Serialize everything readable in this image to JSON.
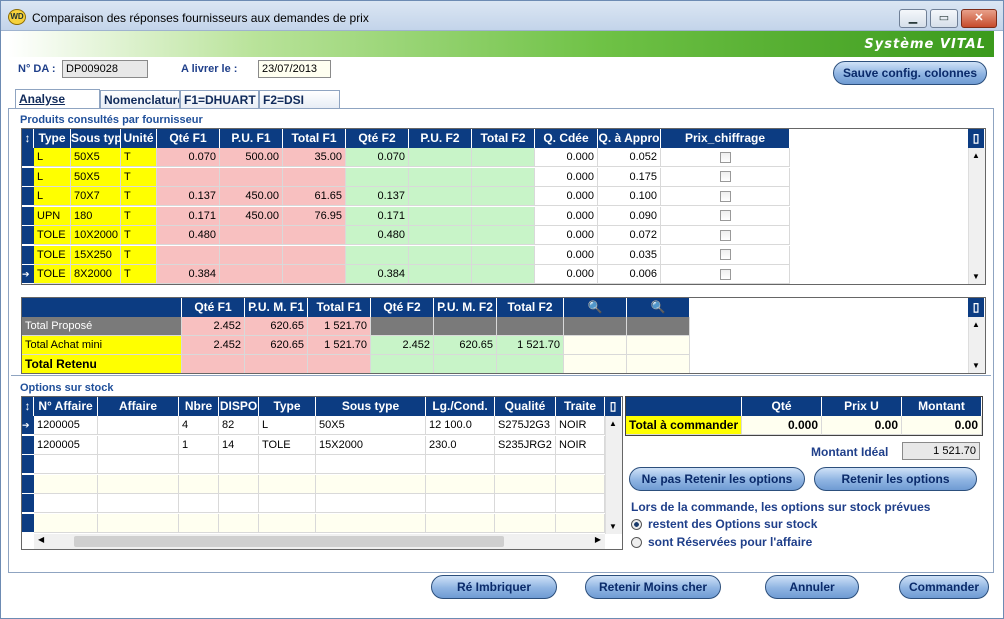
{
  "window": {
    "title": "Comparaison des réponses fournisseurs aux demandes de prix",
    "app_icon": "WD",
    "system_name": "Système VITAL"
  },
  "header": {
    "da_label": "N° DA :",
    "da_value": "DP009028",
    "livrer_label": "A livrer le :",
    "livrer_value": "23/07/2013",
    "sauve_btn": "Sauve config. colonnes"
  },
  "tabs": [
    {
      "label": "Analyse",
      "active": true
    },
    {
      "label": "Nomenclature"
    },
    {
      "label": "F1=DHUART"
    },
    {
      "label": "F2=DSI"
    }
  ],
  "produits": {
    "section_title": "Produits consultés par fournisseur",
    "columns": [
      "Type",
      "Sous type",
      "Unité",
      "Qté F1",
      "P.U. F1",
      "Total F1",
      "Qté F2",
      "P.U. F2",
      "Total F2",
      "Q. Cdée",
      "Q. à Appro",
      "Prix_chiffrage"
    ],
    "rows": [
      [
        "L",
        "50X5",
        "T",
        "0.070",
        "500.00",
        "35.00",
        "0.070",
        "",
        "",
        "0.000",
        "0.052"
      ],
      [
        "L",
        "50X5",
        "T",
        "",
        "",
        "",
        "",
        "",
        "",
        "0.000",
        "0.175"
      ],
      [
        "L",
        "70X7",
        "T",
        "0.137",
        "450.00",
        "61.65",
        "0.137",
        "",
        "",
        "0.000",
        "0.100"
      ],
      [
        "UPN",
        "180",
        "T",
        "0.171",
        "450.00",
        "76.95",
        "0.171",
        "",
        "",
        "0.000",
        "0.090"
      ],
      [
        "TOLE",
        "10X2000",
        "T",
        "0.480",
        "",
        "",
        "0.480",
        "",
        "",
        "0.000",
        "0.072"
      ],
      [
        "TOLE",
        "15X250",
        "T",
        "",
        "",
        "",
        "",
        "",
        "",
        "0.000",
        "0.035"
      ],
      [
        "TOLE",
        "8X2000",
        "T",
        "0.384",
        "",
        "",
        "0.384",
        "",
        "",
        "0.000",
        "0.006"
      ]
    ]
  },
  "totals": {
    "columns": [
      "Qté F1",
      "P.U. M. F1",
      "Total F1",
      "Qté F2",
      "P.U. M. F2",
      "Total F2"
    ],
    "rows": [
      {
        "label": "Total Proposé",
        "values": [
          "2.452",
          "620.65",
          "1 521.70",
          "",
          "",
          ""
        ]
      },
      {
        "label": "Total Achat mini",
        "values": [
          "2.452",
          "620.65",
          "1 521.70",
          "2.452",
          "620.65",
          "1 521.70"
        ]
      },
      {
        "label": "Total Retenu",
        "values": [
          "",
          "",
          "",
          "",
          "",
          ""
        ]
      }
    ]
  },
  "options": {
    "section_title": "Options sur stock",
    "columns": [
      "N° Affaire",
      "Affaire",
      "Nbre",
      "DISPO",
      "Type",
      "Sous type",
      "Lg./Cond.",
      "Qualité",
      "Traite"
    ],
    "rows": [
      [
        "1200005",
        "",
        "4",
        "82",
        "L",
        "50X5",
        "12 100.0",
        "S275J2G3",
        "NOIR"
      ],
      [
        "1200005",
        "",
        "1",
        "14",
        "TOLE",
        "15X2000",
        "230.0",
        "S235JRG2",
        "NOIR"
      ]
    ]
  },
  "commande": {
    "columns": [
      "Qté",
      "Prix U",
      "Montant"
    ],
    "row_label": "Total à commander",
    "values": [
      "0.000",
      "0.00",
      "0.00"
    ],
    "ideal_label": "Montant Idéal",
    "ideal_value": "1 521.70",
    "btn_ne_pas": "Ne pas Retenir les options",
    "btn_retenir": "Retenir les options",
    "info": "Lors de la commande, les options sur stock prévues",
    "radio1": "restent des Options sur stock",
    "radio2": "sont Réservées pour l'affaire"
  },
  "footer": {
    "reimbriquer": "Ré Imbriquer",
    "retenir_moins": "Retenir Moins cher",
    "annuler": "Annuler",
    "commander": "Commander"
  },
  "colors": {
    "header_blue": "#0c3c82",
    "yellow": "#ffff00",
    "pink": "#f8c0c0",
    "green": "#c8f4c8",
    "gray_row": "#7a7a7a"
  }
}
